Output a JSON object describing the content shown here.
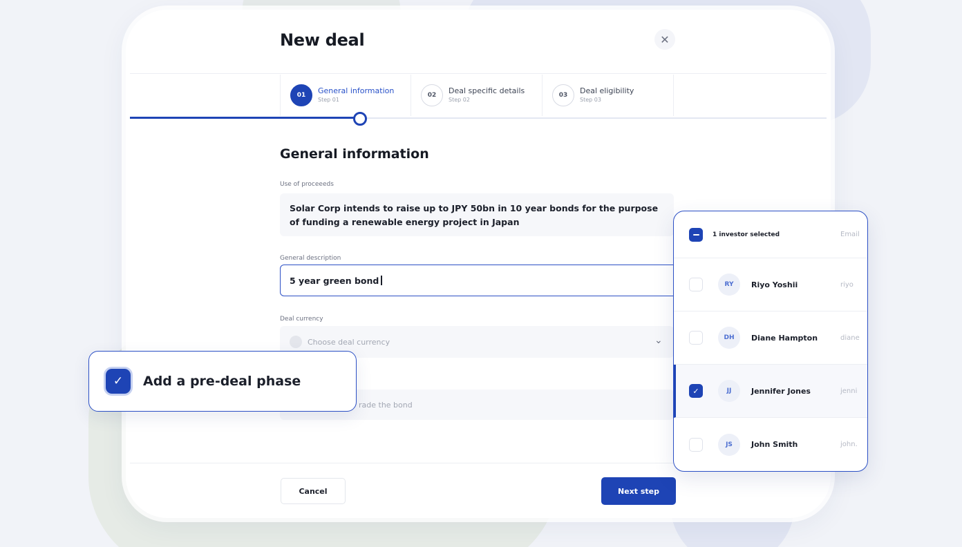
{
  "modal": {
    "title": "New deal",
    "close_icon": "close-icon"
  },
  "steps": [
    {
      "num": "01",
      "title": "General information",
      "sub": "Step 01",
      "active": true
    },
    {
      "num": "02",
      "title": "Deal specific details",
      "sub": "Step 02",
      "active": false
    },
    {
      "num": "03",
      "title": "Deal eligibility",
      "sub": "Step 03",
      "active": false
    }
  ],
  "progress": {
    "current_step": 1,
    "total_steps": 3
  },
  "form": {
    "section_title": "General information",
    "proceeds_label": "Use of proceeeds",
    "proceeds_value": "Solar Corp intends to raise up to JPY 50bn in 10 year bonds for the purpose of funding a renewable energy project in Japan",
    "description_label": "General description",
    "description_value": "5 year green bond",
    "currency_label": "Deal currency",
    "currency_placeholder": "Choose deal currency",
    "partial_text": "rade the bond"
  },
  "footer": {
    "cancel_label": "Cancel",
    "next_label": "Next step"
  },
  "predeal": {
    "label": "Add a pre-deal phase",
    "checked": true
  },
  "investors": {
    "header": "1 investor selected",
    "email_header": "Email",
    "items": [
      {
        "initials": "RY",
        "name": "Riyo Yoshii",
        "email": "riyo",
        "checked": false
      },
      {
        "initials": "DH",
        "name": "Diane Hampton",
        "email": "diane",
        "checked": false
      },
      {
        "initials": "JJ",
        "name": "Jennifer Jones",
        "email": "jenni",
        "checked": true
      },
      {
        "initials": "JS",
        "name": "John Smith",
        "email": "john.",
        "checked": false
      }
    ]
  },
  "colors": {
    "accent": "#1e44b5",
    "background": "#f1f3f8"
  }
}
